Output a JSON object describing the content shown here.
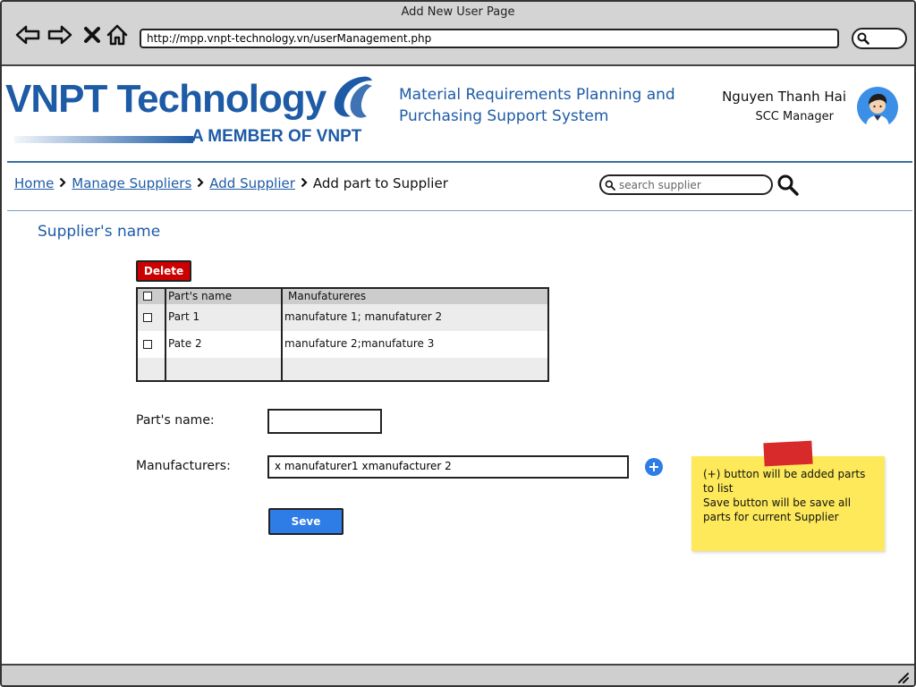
{
  "window": {
    "title": "Add New User Page"
  },
  "browser": {
    "url": "http://mpp.vnpt-technology.vn/userManagement.php"
  },
  "header": {
    "logo_text": "VNPT Technology",
    "logo_subtext": "A MEMBER OF VNPT",
    "app_title": "Material Requirements Planning and Purchasing Support System",
    "user_name": "Nguyen Thanh Hai",
    "user_role": "SCC Manager"
  },
  "breadcrumb": {
    "items": [
      "Home",
      "Manage Suppliers",
      "Add Supplier"
    ],
    "current": "Add part to Supplier"
  },
  "search": {
    "placeholder": "search supplier"
  },
  "main": {
    "section_title": "Supplier's name",
    "delete_label": "Delete",
    "table": {
      "headers": [
        "Part's name",
        "Manufatureres"
      ],
      "rows": [
        {
          "part": "Part 1",
          "manufacturers": "manufature 1; manufaturer 2"
        },
        {
          "part": "Pate 2",
          "manufacturers": "manufature 2;manufature 3"
        }
      ]
    },
    "form": {
      "part_name_label": "Part's name:",
      "part_name_value": "",
      "manufacturers_label": "Manufacturers:",
      "manufacturers_value": "x manufaturer1 xmanufacturer 2",
      "save_label": "Seve"
    },
    "note": "(+) button will be added parts to list\nSave button will be save all parts for current Supplier"
  },
  "colors": {
    "brand": "#1d5ba6",
    "danger": "#cc0000",
    "primary": "#2e7ce6",
    "note": "#fde95a"
  }
}
